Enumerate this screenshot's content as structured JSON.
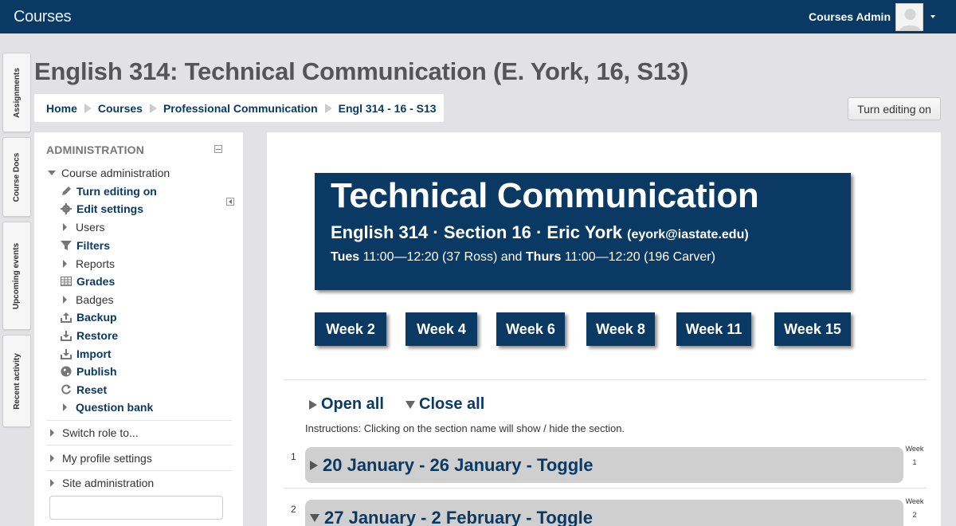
{
  "navbar": {
    "brand": "Courses",
    "username": "Courses Admin"
  },
  "dock": {
    "tabs": [
      "Assignments",
      "Course Docs",
      "Upcoming events",
      "Recent activity"
    ]
  },
  "page_title": "English 314: Technical Communication (E. York, 16, S13)",
  "breadcrumb": {
    "items": [
      "Home",
      "Courses",
      "Professional Communication",
      "Engl 314 - 16 - S13"
    ]
  },
  "editing_button": "Turn editing on",
  "admin": {
    "header": "ADMINISTRATION",
    "course_admin": "Course administration",
    "items": [
      {
        "label": "Turn editing on",
        "link": true,
        "icon": "pencil-icon"
      },
      {
        "label": "Edit settings",
        "link": true,
        "icon": "gear-icon"
      },
      {
        "label": "Users",
        "link": false,
        "icon": "expand-arrow-icon"
      },
      {
        "label": "Filters",
        "link": true,
        "icon": "filter-icon"
      },
      {
        "label": "Reports",
        "link": false,
        "icon": "expand-arrow-icon"
      },
      {
        "label": "Grades",
        "link": true,
        "icon": "grades-table-icon"
      },
      {
        "label": "Badges",
        "link": false,
        "icon": "expand-arrow-icon"
      },
      {
        "label": "Backup",
        "link": true,
        "icon": "backup-icon"
      },
      {
        "label": "Restore",
        "link": true,
        "icon": "restore-icon"
      },
      {
        "label": "Import",
        "link": true,
        "icon": "import-icon"
      },
      {
        "label": "Publish",
        "link": true,
        "icon": "globe-icon"
      },
      {
        "label": "Reset",
        "link": true,
        "icon": "reset-icon"
      },
      {
        "label": "Question bank",
        "link": true,
        "icon": "expand-arrow-icon"
      }
    ],
    "switch_role": "Switch role to...",
    "profile_settings": "My profile settings",
    "site_admin": "Site administration"
  },
  "banner": {
    "title": "Technical Communication",
    "subtitle": "English 314 · Section 16 · Eric York",
    "email": "(eyork@iastate.edu)",
    "day1": "Tues",
    "time1": "11:00—12:20 (37 Ross) and",
    "day2": "Thurs",
    "time2": "11:00—12:20 (196 Carver)"
  },
  "weeks": [
    "Week 2",
    "Week 4",
    "Week 6",
    "Week 8",
    "Week 11",
    "Week 15"
  ],
  "open_all": "Open all",
  "close_all": "Close all",
  "instructions": "Instructions: Clicking on the section name will show / hide the section.",
  "sections": [
    {
      "num": "1",
      "title": "20 January - 26 January - Toggle",
      "week_label": "Week",
      "week_num": "1",
      "state": "collapsed"
    },
    {
      "num": "2",
      "title": "27 January - 2 February - Toggle",
      "week_label": "Week",
      "week_num": "2",
      "state": "expanded"
    }
  ],
  "colors": {
    "navy": "#0a3a63",
    "page_bg": "#e2e2e4",
    "section_bar": "#cfcfcf"
  }
}
